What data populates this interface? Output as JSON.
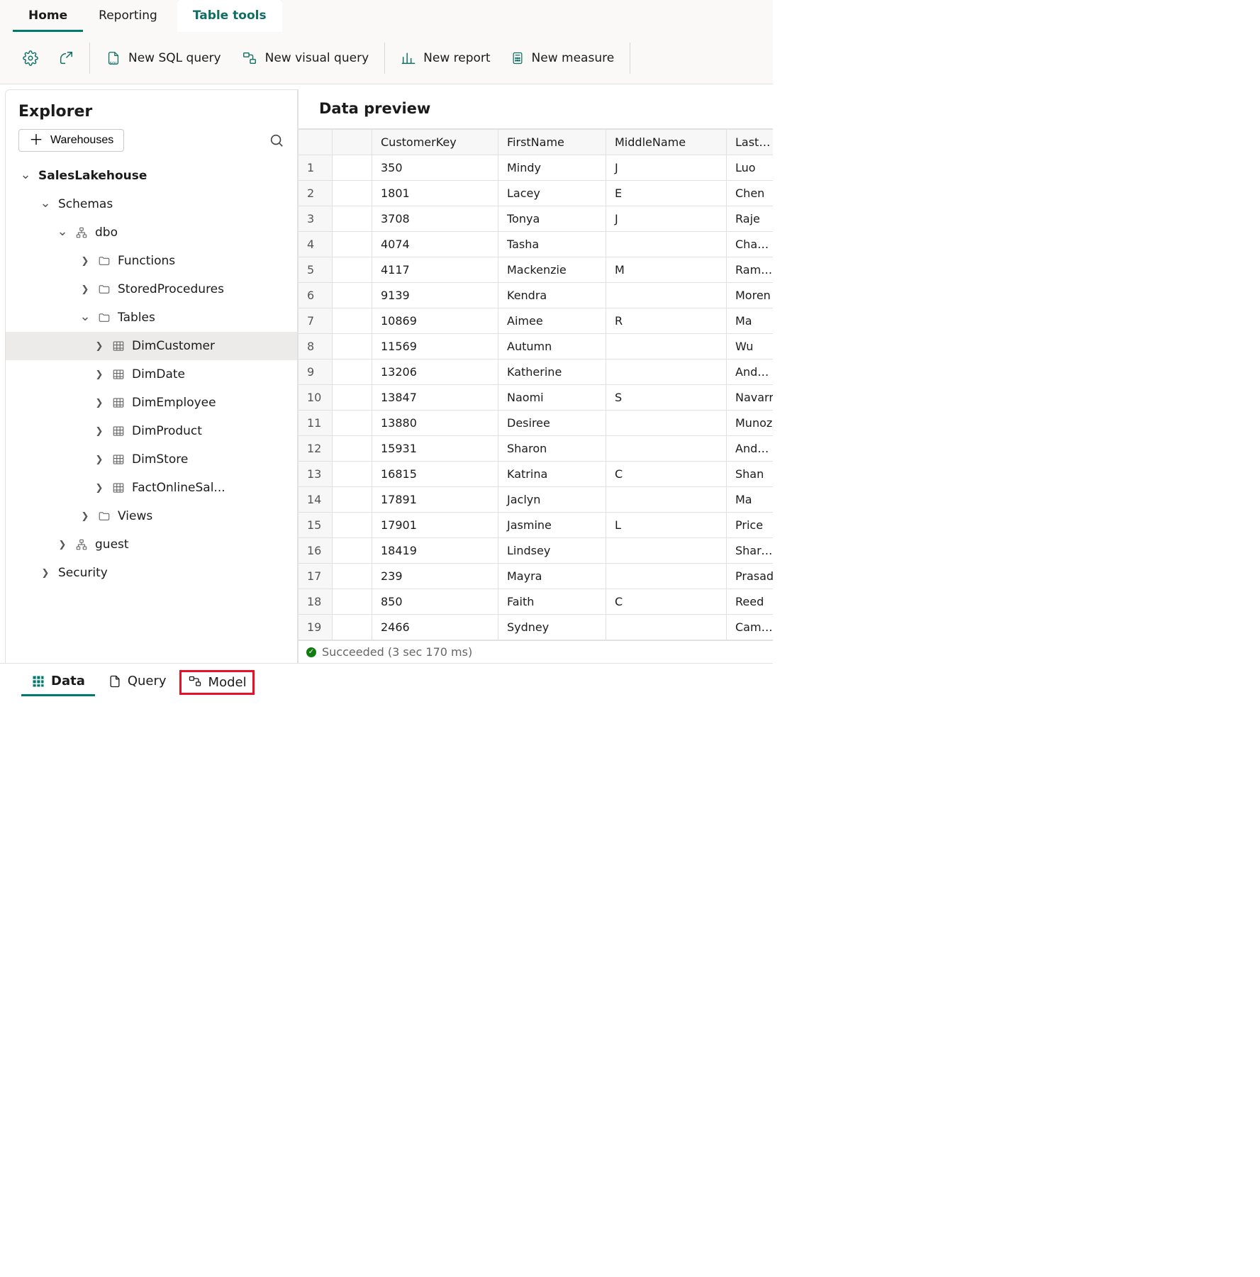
{
  "ribbon": {
    "tabs": {
      "home": "Home",
      "reporting": "Reporting",
      "table_tools": "Table tools"
    },
    "actions": {
      "new_sql": "New SQL query",
      "new_visual": "New visual query",
      "new_report": "New report",
      "new_measure": "New measure"
    }
  },
  "explorer": {
    "title": "Explorer",
    "warehouses_btn": "Warehouses",
    "root": "SalesLakehouse",
    "schemas_label": "Schemas",
    "dbo_label": "dbo",
    "functions_label": "Functions",
    "sprocs_label": "StoredProcedures",
    "tables_label": "Tables",
    "views_label": "Views",
    "guest_label": "guest",
    "security_label": "Security",
    "tables": [
      "DimCustomer",
      "DimDate",
      "DimEmployee",
      "DimProduct",
      "DimStore",
      "FactOnlineSal..."
    ]
  },
  "preview": {
    "title": "Data preview",
    "columns": [
      "CustomerKey",
      "FirstName",
      "MiddleName",
      "LastNa"
    ],
    "rows": [
      {
        "n": "1",
        "ck": "350",
        "fn": "Mindy",
        "mn": "J",
        "ln": "Luo"
      },
      {
        "n": "2",
        "ck": "1801",
        "fn": "Lacey",
        "mn": "E",
        "ln": "Chen"
      },
      {
        "n": "3",
        "ck": "3708",
        "fn": "Tonya",
        "mn": "J",
        "ln": "Raje"
      },
      {
        "n": "4",
        "ck": "4074",
        "fn": "Tasha",
        "mn": "",
        "ln": "Chande"
      },
      {
        "n": "5",
        "ck": "4117",
        "fn": "Mackenzie",
        "mn": "M",
        "ln": "Ramire"
      },
      {
        "n": "6",
        "ck": "9139",
        "fn": "Kendra",
        "mn": "",
        "ln": "Moren"
      },
      {
        "n": "7",
        "ck": "10869",
        "fn": "Aimee",
        "mn": "R",
        "ln": "Ma"
      },
      {
        "n": "8",
        "ck": "11569",
        "fn": "Autumn",
        "mn": "",
        "ln": "Wu"
      },
      {
        "n": "9",
        "ck": "13206",
        "fn": "Katherine",
        "mn": "",
        "ln": "Anders"
      },
      {
        "n": "10",
        "ck": "13847",
        "fn": "Naomi",
        "mn": "S",
        "ln": "Navarr"
      },
      {
        "n": "11",
        "ck": "13880",
        "fn": "Desiree",
        "mn": "",
        "ln": "Munoz"
      },
      {
        "n": "12",
        "ck": "15931",
        "fn": "Sharon",
        "mn": "",
        "ln": "Anders"
      },
      {
        "n": "13",
        "ck": "16815",
        "fn": "Katrina",
        "mn": "C",
        "ln": "Shan"
      },
      {
        "n": "14",
        "ck": "17891",
        "fn": "Jaclyn",
        "mn": "",
        "ln": "Ma"
      },
      {
        "n": "15",
        "ck": "17901",
        "fn": "Jasmine",
        "mn": "L",
        "ln": "Price"
      },
      {
        "n": "16",
        "ck": "18419",
        "fn": "Lindsey",
        "mn": "",
        "ln": "Sharma"
      },
      {
        "n": "17",
        "ck": "239",
        "fn": "Mayra",
        "mn": "",
        "ln": "Prasad"
      },
      {
        "n": "18",
        "ck": "850",
        "fn": "Faith",
        "mn": "C",
        "ln": "Reed"
      },
      {
        "n": "19",
        "ck": "2466",
        "fn": "Sydney",
        "mn": "",
        "ln": "Campb"
      }
    ],
    "status": "Succeeded (3 sec 170 ms)"
  },
  "view_tabs": {
    "data": "Data",
    "query": "Query",
    "model": "Model"
  }
}
